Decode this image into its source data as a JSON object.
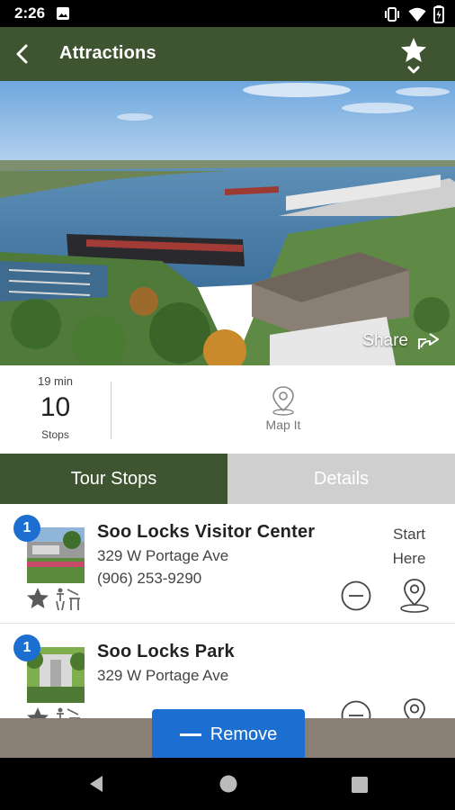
{
  "status_bar": {
    "time": "2:26"
  },
  "app_bar": {
    "title": "Attractions"
  },
  "hero": {
    "share_label": "Share"
  },
  "stats": {
    "duration": "19 min",
    "stop_count": "10",
    "stop_label": "Stops",
    "map_label": "Map It"
  },
  "tabs": [
    {
      "label": "Tour Stops",
      "active": true
    },
    {
      "label": "Details",
      "active": false
    }
  ],
  "stops": [
    {
      "badge": "1",
      "name": "Soo Locks Visitor Center",
      "address": "329 W Portage Ave",
      "phone": "(906) 253-9290",
      "start_line1": "Start",
      "start_line2": "Here"
    },
    {
      "badge": "1",
      "name": "Soo Locks Park",
      "address": "329 W Portage Ave"
    }
  ],
  "remove_button": {
    "label": "Remove"
  },
  "colors": {
    "primary": "#3f5430",
    "accent": "#1c6fd0",
    "tab_inactive": "#cfcfcf"
  }
}
